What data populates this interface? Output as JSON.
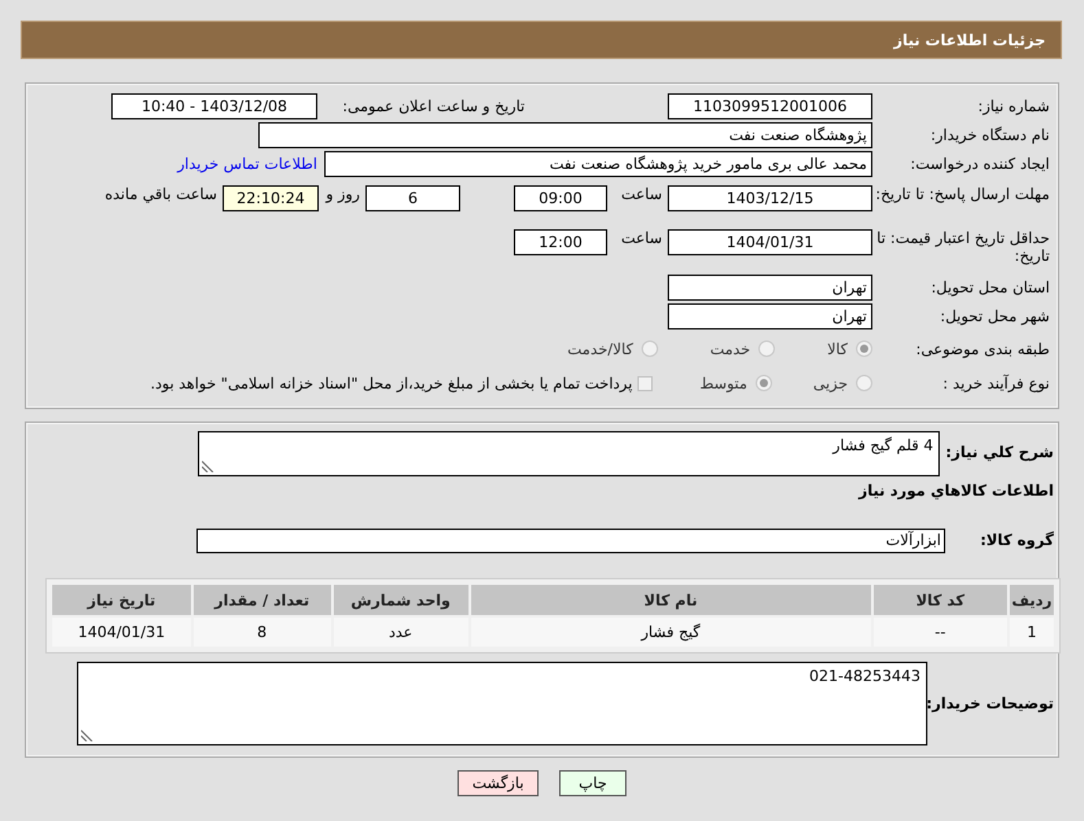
{
  "header": {
    "title": "جزئیات اطلاعات نیاز"
  },
  "need_number": {
    "label": "شماره نیاز:",
    "value": "1103099512001006"
  },
  "announce": {
    "label": "تاریخ و ساعت اعلان عمومی:",
    "value": "1403/12/08 - 10:40"
  },
  "buyer_org": {
    "label": "نام دستگاه خریدار:",
    "value": "پژوهشگاه صنعت نفت"
  },
  "requester": {
    "label": "ایجاد کننده درخواست:",
    "value": "محمد عالی بری مامور خرید پژوهشگاه صنعت نفت",
    "link": "اطلاعات تماس خریدار"
  },
  "reply_deadline": {
    "label": "مهلت ارسال پاسخ: تا تاریخ:",
    "date": "1403/12/15",
    "time_label": "ساعت",
    "time": "09:00",
    "days": "6",
    "days_label": "روز و",
    "remaining": "22:10:24",
    "remaining_label": "ساعت باقي مانده"
  },
  "price_validity": {
    "label": "حداقل تاریخ اعتبار قیمت: تا تاریخ:",
    "date": "1404/01/31",
    "time_label": "ساعت",
    "time": "12:00"
  },
  "province": {
    "label": "استان محل تحویل:",
    "value": "تهران"
  },
  "city": {
    "label": "شهر محل تحویل:",
    "value": "تهران"
  },
  "category": {
    "label": "طبقه بندی موضوعی:",
    "options": [
      {
        "label": "کالا",
        "selected": true
      },
      {
        "label": "خدمت",
        "selected": false
      },
      {
        "label": "کالا/خدمت",
        "selected": false
      }
    ]
  },
  "process": {
    "label": "نوع فرآیند خرید :",
    "options": [
      {
        "label": "جزیی",
        "selected": false
      },
      {
        "label": "متوسط",
        "selected": true
      }
    ],
    "payment_note": {
      "text": "پرداخت تمام یا بخشی از مبلغ خرید،از محل \"اسناد خزانه اسلامی\" خواهد بود.",
      "checked": false
    }
  },
  "description": {
    "label": "شرح کلي نیاز:",
    "value": "4 قلم گیج فشار"
  },
  "items_heading": "اطلاعات کالاهاي مورد نیاز",
  "goods_group": {
    "label": "گروه کالا:",
    "value": "ابزارآلات"
  },
  "table": {
    "columns": [
      "ردیف",
      "کد کالا",
      "نام کالا",
      "واحد شمارش",
      "تعداد / مقدار",
      "تاریخ نیاز"
    ],
    "rows": [
      [
        "1",
        "--",
        "گیج فشار",
        "عدد",
        "8",
        "1404/01/31"
      ]
    ]
  },
  "buyer_notes": {
    "label": "توضیحات خریدار:",
    "value": "021-48253443"
  },
  "buttons": [
    {
      "label": "چاپ",
      "kind": "print"
    },
    {
      "label": "بازگشت",
      "kind": "back"
    }
  ]
}
